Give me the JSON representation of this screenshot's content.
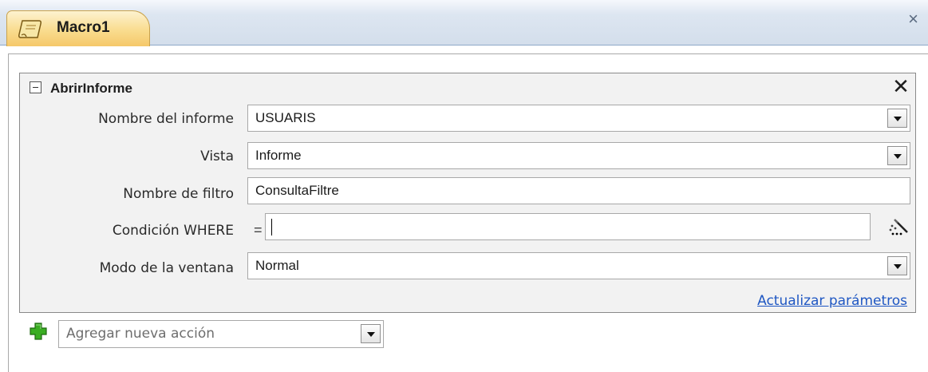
{
  "tab": {
    "title": "Macro1",
    "close": "×"
  },
  "action": {
    "name": "AbrirInforme",
    "delete": "✕",
    "update_link": "Actualizar parámetros",
    "arguments": [
      {
        "label": "Nombre del informe",
        "value": "USUARIS"
      },
      {
        "label": "Vista",
        "value": "Informe"
      },
      {
        "label": "Nombre de filtro",
        "value": "ConsultaFiltre"
      },
      {
        "label": "Condición WHERE",
        "prefix": "=",
        "value": ""
      },
      {
        "label": "Modo de la ventana",
        "value": "Normal"
      }
    ]
  },
  "add_action": {
    "placeholder": "Agregar nueva acción"
  },
  "colors": {
    "tab": "#f9dc8e",
    "link": "#1f57c3",
    "plus": "#2e9a1a",
    "block": "#f2f2f2"
  }
}
